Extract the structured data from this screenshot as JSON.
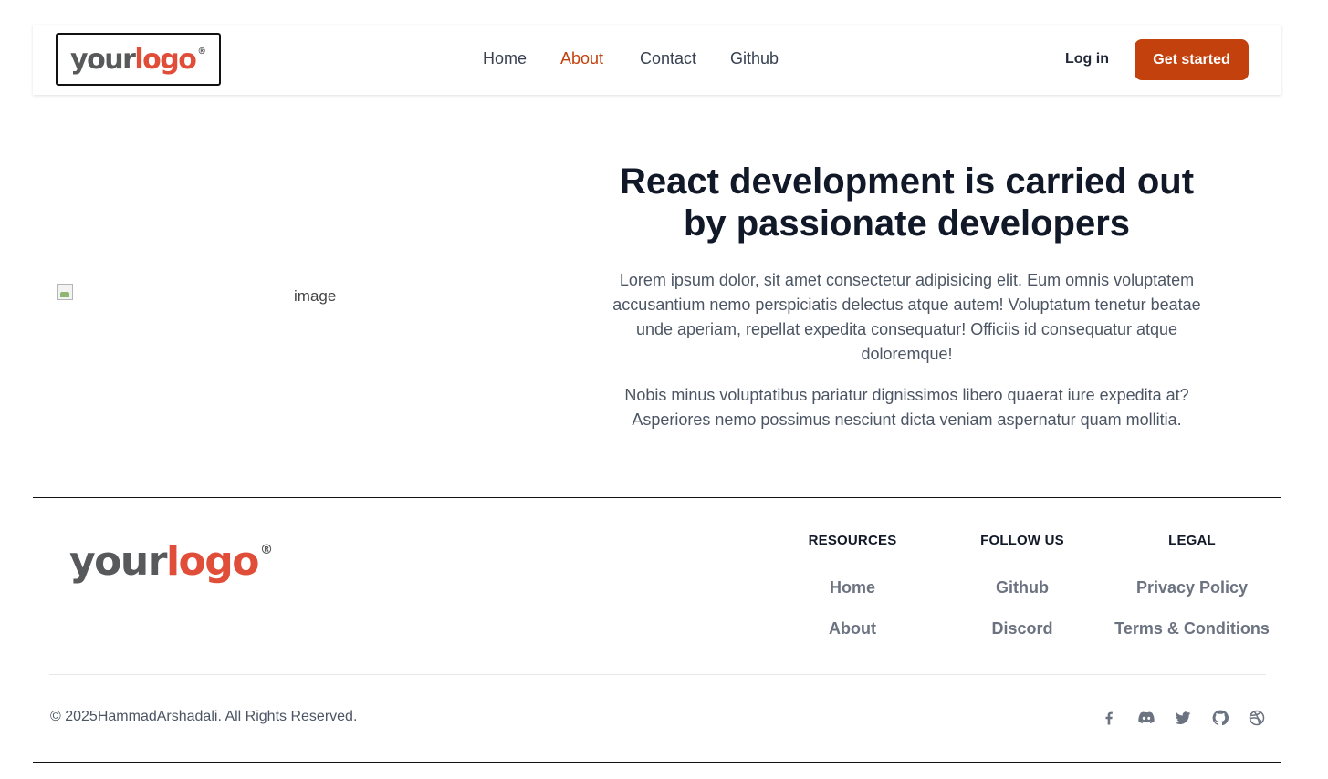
{
  "header": {
    "logo": {
      "your": "your",
      "logo": "logo",
      "reg": "®"
    },
    "nav": [
      {
        "label": "Home",
        "active": false
      },
      {
        "label": "About",
        "active": true
      },
      {
        "label": "Contact",
        "active": false
      },
      {
        "label": "Github",
        "active": false
      }
    ],
    "login_label": "Log in",
    "cta_label": "Get started",
    "accent_color": "#c2410c"
  },
  "main": {
    "image_alt": "image",
    "headline_line1": "React development is carried out",
    "headline_line2": "by passionate developers",
    "paragraph1": "Lorem ipsum dolor, sit amet consectetur adipisicing elit. Eum omnis voluptatem accusantium nemo perspiciatis delectus atque autem! Voluptatum tenetur beatae unde aperiam, repellat expedita consequatur! Officiis id consequatur atque doloremque!",
    "paragraph2": "Nobis minus voluptatibus pariatur dignissimos libero quaerat iure expedita at? Asperiores nemo possimus nesciunt dicta veniam aspernatur quam mollitia."
  },
  "footer": {
    "logo": {
      "your": "your",
      "logo": "logo",
      "reg": "®"
    },
    "columns": [
      {
        "title": "RESOURCES",
        "links": [
          "Home",
          "About"
        ]
      },
      {
        "title": "FOLLOW US",
        "links": [
          "Github",
          "Discord"
        ]
      },
      {
        "title": "LEGAL",
        "links": [
          "Privacy Policy",
          "Terms & Conditions"
        ]
      }
    ],
    "copyright": "© 2025HammadArshadali. All Rights Reserved.",
    "social_icons": [
      "facebook-icon",
      "discord-icon",
      "twitter-icon",
      "github-icon",
      "dribbble-icon"
    ]
  }
}
